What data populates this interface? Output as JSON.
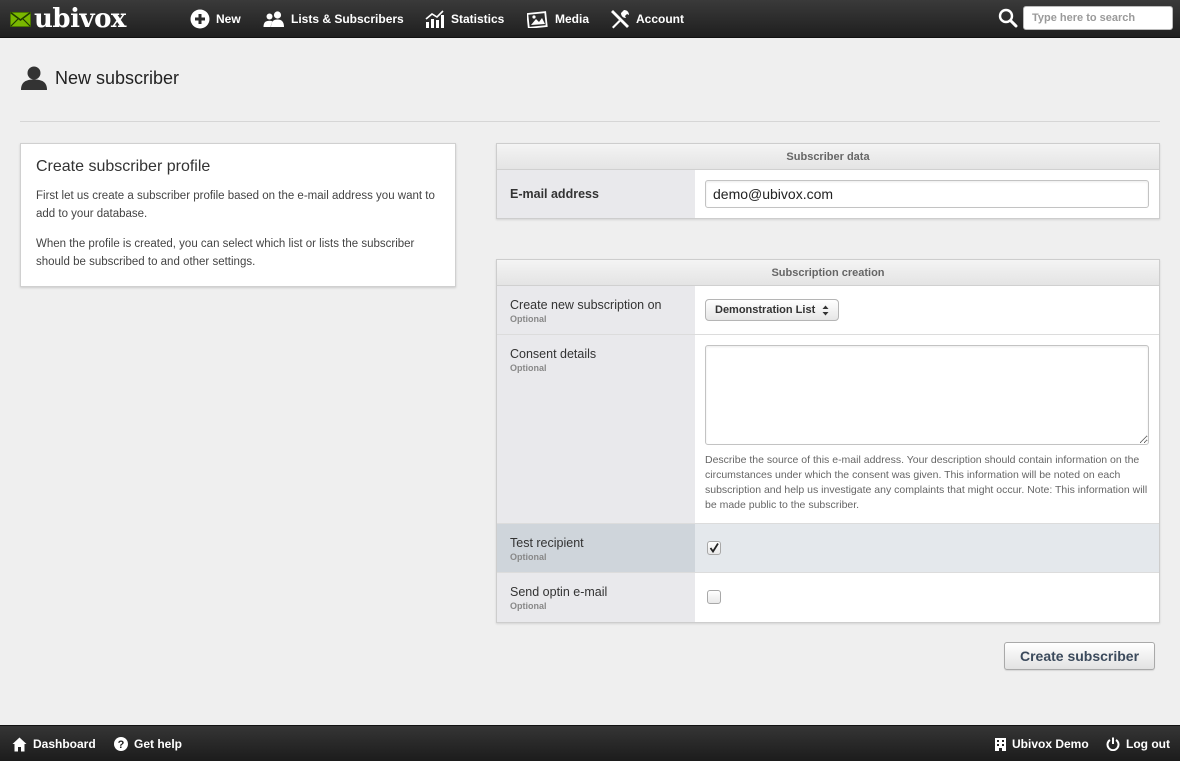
{
  "app": {
    "logo_text": "ubivox"
  },
  "nav": {
    "items": [
      {
        "label": "New",
        "icon": "plus-circle-icon"
      },
      {
        "label": "Lists & Subscribers",
        "icon": "users-icon"
      },
      {
        "label": "Statistics",
        "icon": "chart-icon"
      },
      {
        "label": "Media",
        "icon": "image-icon"
      },
      {
        "label": "Account",
        "icon": "tools-icon"
      }
    ],
    "search_placeholder": "Type here to search"
  },
  "page": {
    "title": "New subscriber",
    "icon": "user-icon"
  },
  "info": {
    "title": "Create subscriber profile",
    "p1": "First let us create a subscriber profile based on the e-mail address you want to add to your database.",
    "p2": "When the profile is created, you can select which list or lists the subscriber should be subscribed to and other settings."
  },
  "subscriber_data": {
    "header": "Subscriber data",
    "email_label": "E-mail address",
    "email_value": "demo@ubivox.com"
  },
  "subscription": {
    "header": "Subscription creation",
    "optional": "Optional",
    "list_label": "Create new subscription on",
    "list_selected": "Demonstration List",
    "consent_label": "Consent details",
    "consent_help": "Describe the source of this e-mail address. Your description should contain information on the circumstances under which the consent was given. This information will be noted on each subscription and help us investigate any complaints that might occur. Note: This information will be made public to the subscriber.",
    "test_label": "Test recipient",
    "test_checked": true,
    "optin_label": "Send optin e-mail",
    "optin_checked": false
  },
  "actions": {
    "create_label": "Create subscriber"
  },
  "footer": {
    "dashboard": "Dashboard",
    "help": "Get help",
    "account": "Ubivox Demo",
    "logout": "Log out"
  },
  "colors": {
    "topbar": "#262626",
    "logo_green": "#7ab800",
    "button_text": "#3b4a5c"
  }
}
